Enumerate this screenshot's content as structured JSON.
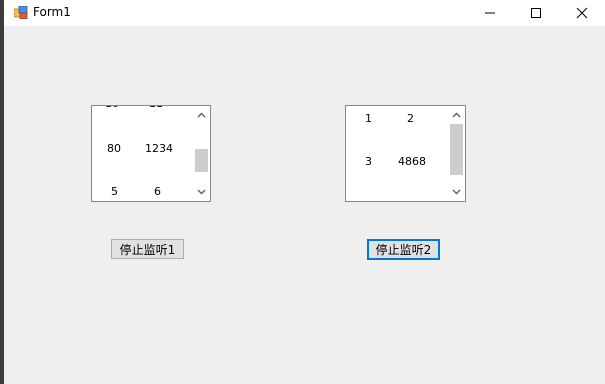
{
  "window": {
    "title": "Form1",
    "controls": {
      "minimize": "minimize-icon",
      "maximize": "maximize-icon",
      "close": "close-icon"
    }
  },
  "listbox1": {
    "rows": [
      [
        "80",
        "1234"
      ],
      [
        "5",
        "6"
      ]
    ]
  },
  "listbox2": {
    "rows": [
      [
        "1",
        "2"
      ],
      [
        "3",
        "4868"
      ]
    ]
  },
  "buttons": {
    "stop1": "停止监听1",
    "stop2": "停止监听2"
  },
  "colors": {
    "focus_border": "#0078d7",
    "button_bg": "#e1e1e1",
    "client_bg": "#efefef"
  }
}
